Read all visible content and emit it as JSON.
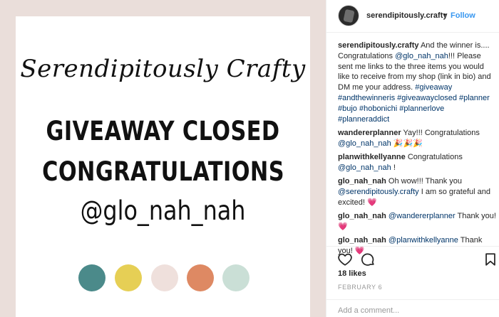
{
  "image": {
    "script_title": "Serendipitously Crafty",
    "headline_1": "GIVEAWAY CLOSED",
    "headline_2": "CONGRATULATIONS",
    "handle": "@glo_nah_nah",
    "swatch_colors": [
      "#4b8a8a",
      "#e6cf55",
      "#efe0dc",
      "#de8963",
      "#cadfd6"
    ],
    "background_color": "#eadeda"
  },
  "header": {
    "username": "serendipitously.crafty",
    "dot": "•",
    "follow_label": "Follow"
  },
  "caption": {
    "user": "serendipitously.crafty",
    "text_1": "And the winner is.... Congratulations",
    "mention": "@glo_nah_nah",
    "text_2": "!!! Please sent me links to the three items you would like to receive from my shop (link in bio) and DM me your address.",
    "hashtags": "#giveaway #andthewinneris #giveawayclosed #planner #bujo #hobonichi #plannerlove #planneraddict"
  },
  "comments": [
    {
      "user": "wandererplanner",
      "text": "Yay!!! Congratulations",
      "mention": "@glo_nah_nah",
      "trail": " 🎉🎉🎉"
    },
    {
      "user": "planwithkellyanne",
      "text": "Congratulations",
      "mention": "@glo_nah_nah",
      "trail": " !"
    },
    {
      "user": "glo_nah_nah",
      "text": "Oh wow!!! Thank you",
      "mention": "@serendipitously.crafty",
      "trail": " I am so grateful and excited! 💗"
    },
    {
      "user": "glo_nah_nah",
      "text": "",
      "mention": "@wandererplanner",
      "trail": " Thank you! 💗"
    },
    {
      "user": "glo_nah_nah",
      "text": "",
      "mention": "@planwithkellyanne",
      "trail": " Thank you! 💗"
    }
  ],
  "actions": {
    "icons": [
      "heart-icon",
      "comment-icon",
      "bookmark-icon"
    ]
  },
  "likes": "18 likes",
  "date": "FEBRUARY 6",
  "add_comment": {
    "placeholder": "Add a comment..."
  }
}
